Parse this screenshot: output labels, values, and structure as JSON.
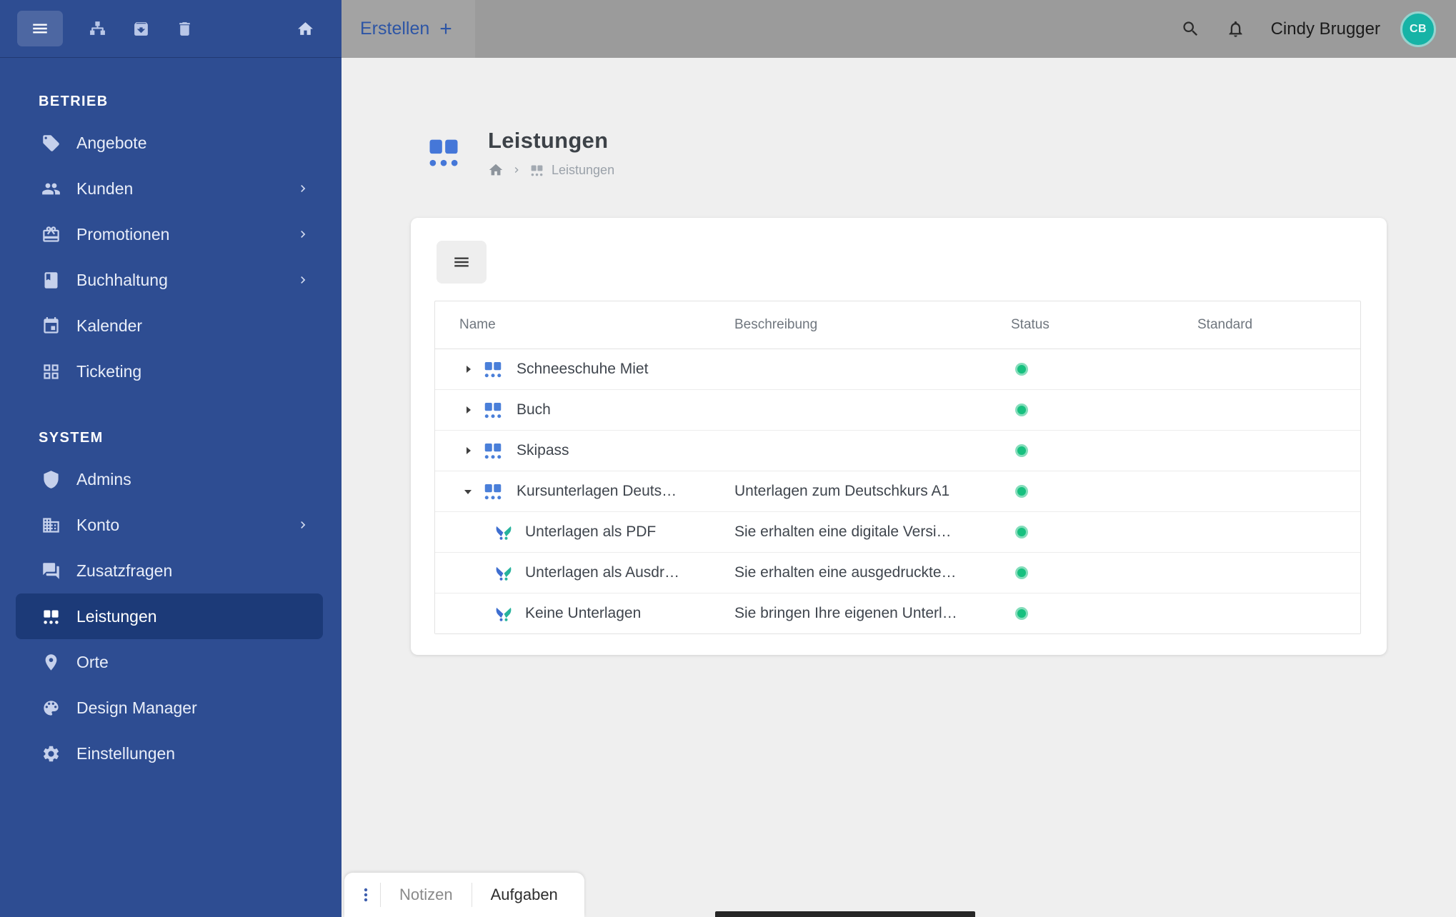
{
  "colors": {
    "sidebar": "#2e4d92",
    "sidebar_active": "#1c3a78",
    "topbar": "#9b9b9b",
    "accent_blue": "#2d55a5",
    "status_green": "#17c07f",
    "avatar_teal": "#16b3a6"
  },
  "topbar": {
    "create_label": "Erstellen",
    "plus": "+",
    "user_name": "Cindy Brugger",
    "avatar_initials": "CB"
  },
  "sidebar": {
    "sections": [
      {
        "label": "BETRIEB",
        "items": [
          {
            "label": "Angebote",
            "icon": "tag",
            "chevron": false,
            "active": false
          },
          {
            "label": "Kunden",
            "icon": "users",
            "chevron": true,
            "active": false
          },
          {
            "label": "Promotionen",
            "icon": "gift",
            "chevron": true,
            "active": false
          },
          {
            "label": "Buchhaltung",
            "icon": "book",
            "chevron": true,
            "active": false
          },
          {
            "label": "Kalender",
            "icon": "calendar",
            "chevron": false,
            "active": false
          },
          {
            "label": "Ticketing",
            "icon": "ticket",
            "chevron": false,
            "active": false
          }
        ]
      },
      {
        "label": "SYSTEM",
        "items": [
          {
            "label": "Admins",
            "icon": "shield",
            "chevron": false,
            "active": false
          },
          {
            "label": "Konto",
            "icon": "building",
            "chevron": true,
            "active": false
          },
          {
            "label": "Zusatzfragen",
            "icon": "chat",
            "chevron": false,
            "active": false
          },
          {
            "label": "Leistungen",
            "icon": "services",
            "chevron": false,
            "active": true
          },
          {
            "label": "Orte",
            "icon": "pin",
            "chevron": false,
            "active": false
          },
          {
            "label": "Design Manager",
            "icon": "palette",
            "chevron": false,
            "active": false
          },
          {
            "label": "Einstellungen",
            "icon": "gear",
            "chevron": false,
            "active": false
          }
        ]
      }
    ]
  },
  "page": {
    "title": "Leistungen",
    "breadcrumb_current": "Leistungen"
  },
  "table": {
    "columns": [
      "Name",
      "Beschreibung",
      "Status",
      "Standard"
    ],
    "rows": [
      {
        "name": "Schneeschuhe Miet",
        "description": "",
        "status": "active",
        "type": "parent",
        "expanded": false
      },
      {
        "name": "Buch",
        "description": "",
        "status": "active",
        "type": "parent",
        "expanded": false
      },
      {
        "name": "Skipass",
        "description": "",
        "status": "active",
        "type": "parent",
        "expanded": false
      },
      {
        "name": "Kursunterlagen Deuts…",
        "description": "Unterlagen zum Deutschkurs A1",
        "status": "active",
        "type": "parent",
        "expanded": true
      },
      {
        "name": "Unterlagen als PDF",
        "description": "Sie erhalten eine digitale Versi…",
        "status": "active",
        "type": "child"
      },
      {
        "name": "Unterlagen als Ausdr…",
        "description": "Sie erhalten eine ausgedruckte…",
        "status": "active",
        "type": "child"
      },
      {
        "name": "Keine Unterlagen",
        "description": "Sie bringen Ihre eigenen Unterl…",
        "status": "active",
        "type": "child"
      }
    ]
  },
  "bottom_bar": {
    "tabs": [
      {
        "label": "Notizen",
        "active": false
      },
      {
        "label": "Aufgaben",
        "active": true
      }
    ]
  }
}
